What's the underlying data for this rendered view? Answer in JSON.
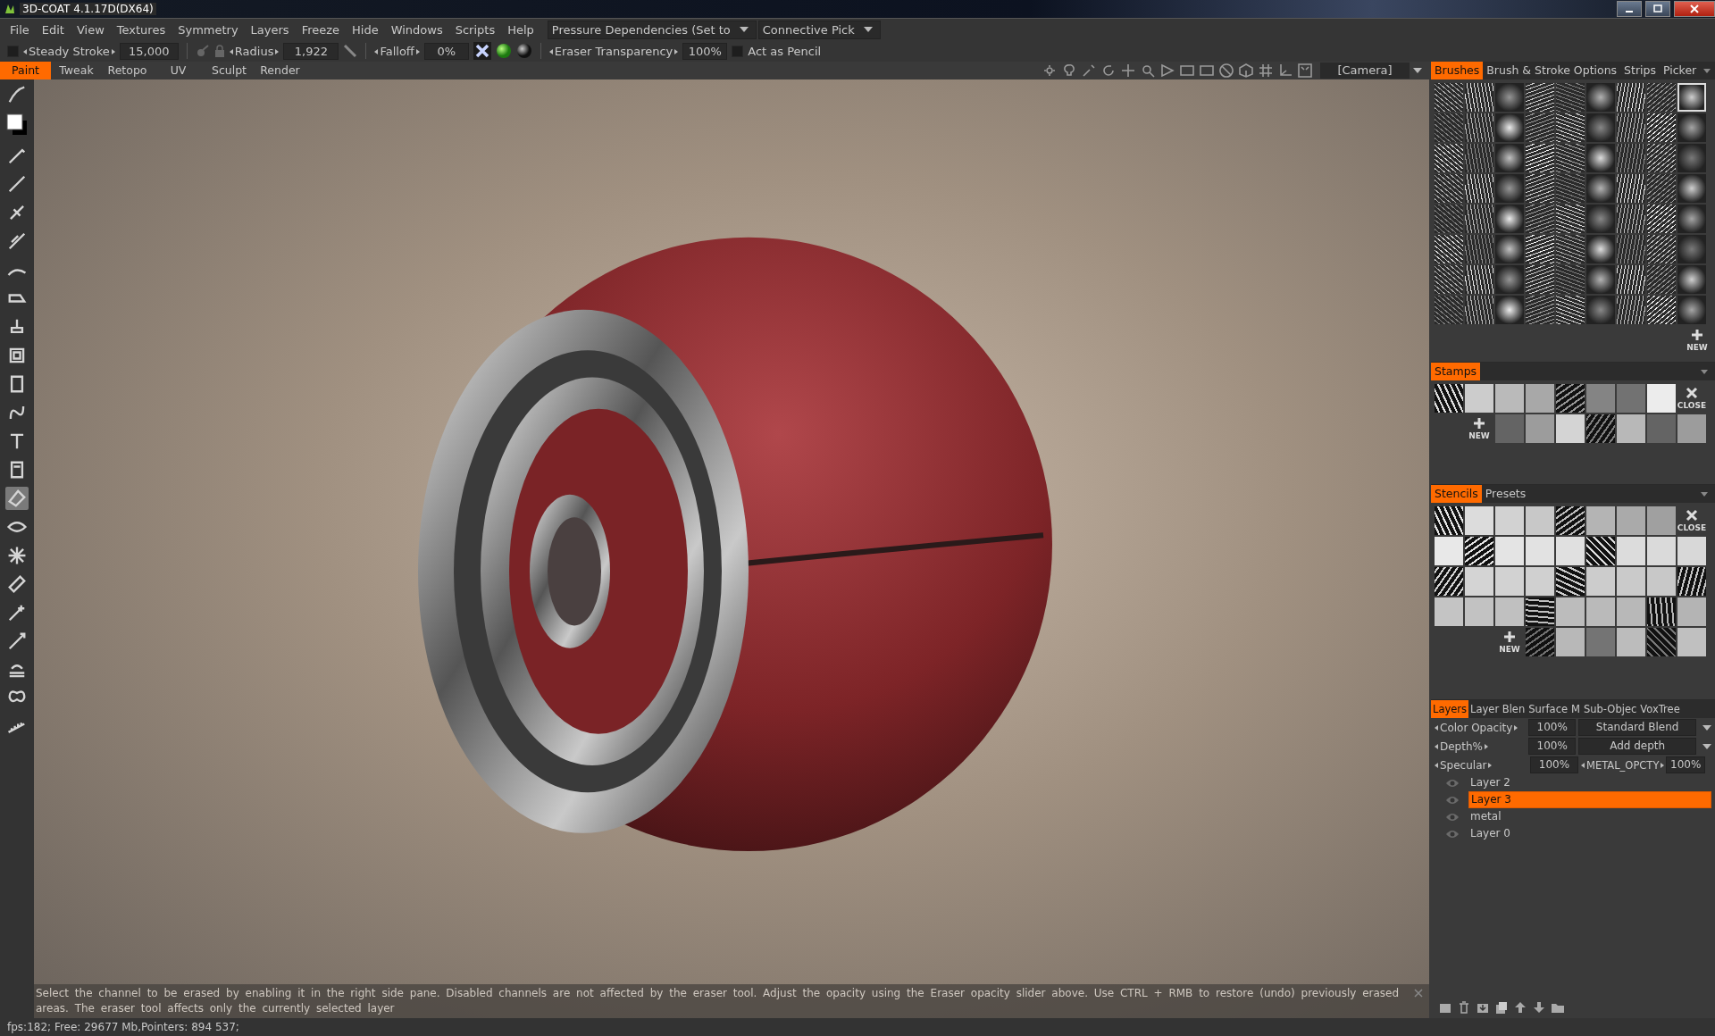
{
  "window": {
    "title": "3D-COAT 4.1.17D(DX64)"
  },
  "menu": [
    "File",
    "Edit",
    "View",
    "Textures",
    "Symmetry",
    "Layers",
    "Freeze",
    "Hide",
    "Windows",
    "Scripts",
    "Help"
  ],
  "menu_dropdowns": [
    "Pressure Dependencies (Set to",
    "Connective Pick"
  ],
  "toolbar": {
    "steady_stroke": {
      "checked": false,
      "label": "Steady Stroke",
      "value": "15,000"
    },
    "radius": {
      "label": "Radius",
      "value": "1,922"
    },
    "falloff": {
      "label": "Falloff",
      "value": "0%"
    },
    "eraser_transparency": {
      "label": "Eraser Transparency",
      "value": "100%"
    },
    "act_as_pencil": {
      "checked": false,
      "label": "Act as Pencil"
    }
  },
  "rooms": [
    {
      "label": "Paint",
      "selected": true
    },
    {
      "label": "Tweak",
      "selected": false
    },
    {
      "label": "Retopo",
      "selected": false
    },
    {
      "label": "UV",
      "selected": false
    },
    {
      "label": "Sculpt",
      "selected": false
    },
    {
      "label": "Render",
      "selected": false
    }
  ],
  "camera": "[Camera]",
  "left_tools": [
    {
      "selected": false
    },
    {
      "selected": false
    },
    {
      "selected": false
    },
    {
      "selected": false
    },
    {
      "selected": false
    },
    {
      "selected": false
    },
    {
      "selected": false
    },
    {
      "selected": false
    },
    {
      "selected": false
    },
    {
      "selected": false
    },
    {
      "selected": false
    },
    {
      "selected": false
    },
    {
      "selected": false
    },
    {
      "selected": true
    },
    {
      "selected": false
    },
    {
      "selected": false
    },
    {
      "selected": false
    },
    {
      "selected": false
    },
    {
      "selected": false
    },
    {
      "selected": false
    },
    {
      "selected": false
    },
    {
      "selected": false
    }
  ],
  "right_tabs": [
    {
      "label": "Brushes",
      "selected": true
    },
    {
      "label": "Brush & Stroke Options",
      "selected": false
    },
    {
      "label": "Strips",
      "selected": false
    },
    {
      "label": "Picker",
      "selected": false
    }
  ],
  "brushes": {
    "new_label": "NEW"
  },
  "stamps": {
    "tabs": [
      {
        "label": "Stamps",
        "selected": true
      }
    ],
    "close_label": "CLOSE",
    "new_label": "NEW"
  },
  "stencils": {
    "tabs": [
      {
        "label": "Stencils",
        "selected": true
      },
      {
        "label": "Presets",
        "selected": false
      }
    ],
    "close_label": "CLOSE",
    "new_label": "NEW"
  },
  "layers_panel": {
    "tabs": [
      {
        "label": "Layers",
        "selected": true
      },
      {
        "label": "Layer Blen",
        "selected": false
      },
      {
        "label": "Surface",
        "selected": false
      },
      {
        "label": "M",
        "selected": false
      },
      {
        "label": "Sub-Objec",
        "selected": false
      },
      {
        "label": "VoxTree",
        "selected": false
      }
    ],
    "properties": [
      {
        "kind": "select",
        "label": "Color Opacity",
        "value": "100%",
        "option": "Standard Blend"
      },
      {
        "kind": "select",
        "label": "Depth%",
        "value": "100%",
        "option": "Add depth"
      },
      {
        "kind": "pair",
        "label": "Specular",
        "value": "100%",
        "label2": "METAL_OPCTY",
        "value2": "100%"
      }
    ],
    "layers": [
      {
        "name": "Layer 2",
        "selected": false
      },
      {
        "name": "Layer 3",
        "selected": true
      },
      {
        "name": "metal",
        "selected": false
      },
      {
        "name": "Layer 0",
        "selected": false
      }
    ]
  },
  "hint": "Select the channel to be erased by enabling it in the right side pane.  Disabled channels are not affected by the eraser tool. Adjust the opacity using the Eraser opacity slider above. Use CTRL + RMB to restore (undo) previously erased areas. The eraser tool affects only the currently selected layer",
  "status": "fps:182;  Free: 29677 Mb,Pointers: 894 537;"
}
